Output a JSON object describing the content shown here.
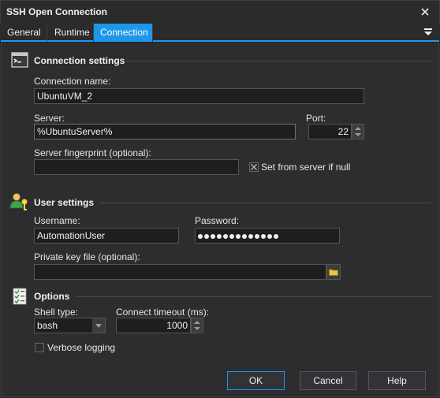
{
  "window": {
    "title": "SSH Open Connection"
  },
  "tabs": [
    {
      "label": "General"
    },
    {
      "label": "Runtime"
    },
    {
      "label": "Connection"
    }
  ],
  "icons": {
    "close": "close-icon",
    "menu": "hamburger-icon",
    "connection_section": "terminal-icon",
    "user_section": "users-icon",
    "options_section": "checklist-icon",
    "browse": "folder-icon"
  },
  "colors": {
    "accent": "#1c97ea",
    "background": "#2d2d30",
    "field": "#1e1e1e"
  },
  "connection": {
    "title": "Connection settings",
    "name_label": "Connection name:",
    "name_value": "UbuntuVM_2",
    "server_label": "Server:",
    "server_value": "%UbuntuServer%",
    "port_label": "Port:",
    "port_value": "22",
    "fingerprint_label": "Server fingerprint (optional):",
    "fingerprint_value": "",
    "set_from_server_label": "Set from server if null",
    "set_from_server_checked": true
  },
  "user": {
    "title": "User settings",
    "username_label": "Username:",
    "username_value": "AutomationUser",
    "password_label": "Password:",
    "password_length": 13,
    "keyfile_label": "Private key file (optional):",
    "keyfile_value": ""
  },
  "options": {
    "title": "Options",
    "shell_label": "Shell type:",
    "shell_value": "bash",
    "timeout_label": "Connect timeout (ms):",
    "timeout_value": "1000",
    "verbose_label": "Verbose logging",
    "verbose_checked": false
  },
  "buttons": {
    "ok": "OK",
    "cancel": "Cancel",
    "help": "Help"
  }
}
